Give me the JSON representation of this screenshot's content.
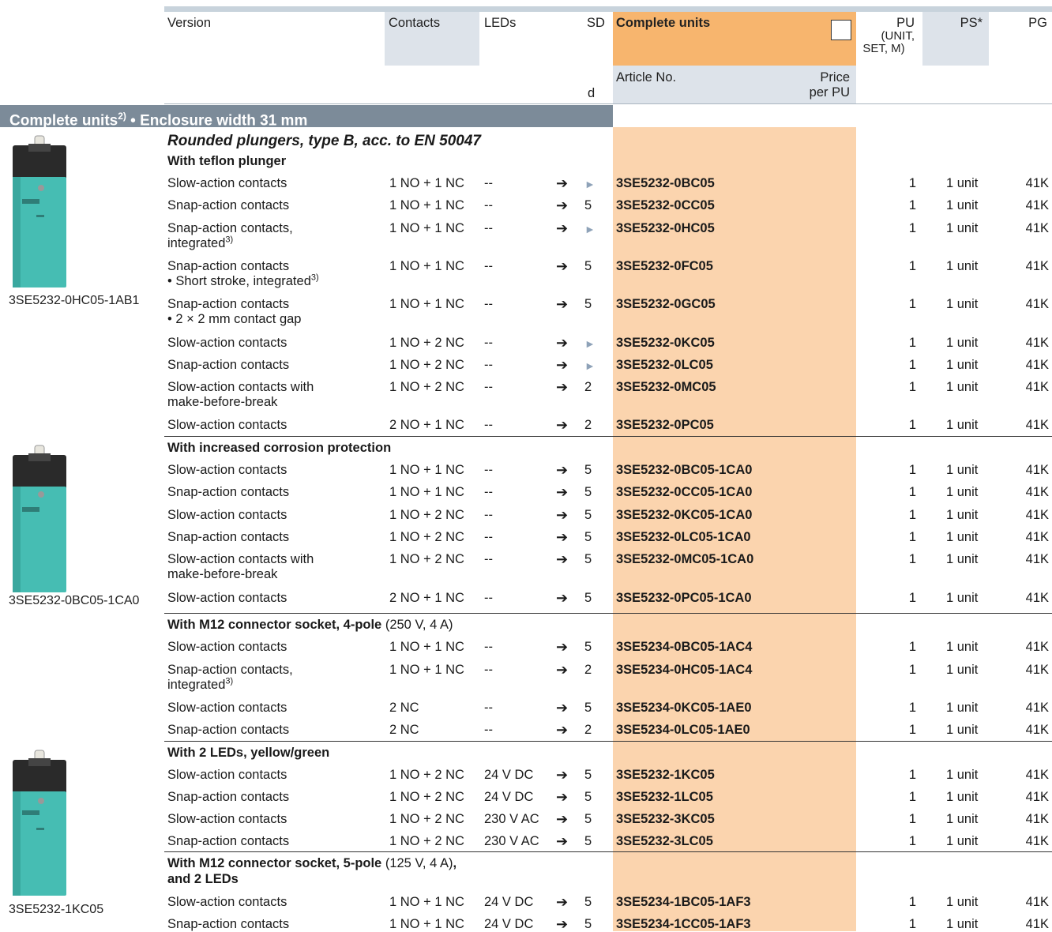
{
  "header": {
    "version": "Version",
    "contacts": "Contacts",
    "leds": "LEDs",
    "sd": "SD",
    "sd_unit": "d",
    "complete_units": "Complete units",
    "article_no": "Article No.",
    "price_line1": "Price",
    "price_line2": "per PU",
    "pu_line1": "PU",
    "pu_line2": "(UNIT,",
    "pu_line3": "SET, M)",
    "ps": "PS*",
    "pg": "PG"
  },
  "section": {
    "label": "Complete units",
    "sup": "2)",
    "rest": " • Enclosure width 31 mm"
  },
  "title": "Rounded plungers, type B, acc. to EN 50047",
  "subheads": {
    "teflon": "With teflon plunger",
    "corrosion": "With increased corrosion protection",
    "m12_4_bold": "With M12 connector socket, 4-pole",
    "m12_4_norm": " (250 V, 4 A)",
    "leds": "With 2 LEDs, yellow/green",
    "m12_5_bold": "With M12 connector socket, 5-pole",
    "m12_5_norm": " (125 V, 4 A)",
    "m12_5_comma": ",",
    "m12_5_line2": "and 2 LEDs"
  },
  "captions": {
    "img1": "3SE5232-0HC05-1AB1",
    "img2": "3SE5232-0BC05-1CA0",
    "img3": "3SE5232-1KC05"
  },
  "rows": [
    {
      "v1": "Slow-action contacts",
      "v2": "",
      "sup": "",
      "contacts": "1 NO + 1 NC",
      "leds": "--",
      "arrow": "➔",
      "sd": "►",
      "article": "3SE5232-0BC05",
      "pu": "1",
      "ps": "1 unit",
      "pg": "41K"
    },
    {
      "v1": "Snap-action contacts",
      "v2": "",
      "sup": "",
      "contacts": "1 NO + 1 NC",
      "leds": "--",
      "arrow": "➔",
      "sd": "5",
      "article": "3SE5232-0CC05",
      "pu": "1",
      "ps": "1 unit",
      "pg": "41K"
    },
    {
      "v1": "Snap-action contacts,",
      "v2": "integrated",
      "sup": "3)",
      "contacts": "1 NO + 1 NC",
      "leds": "--",
      "arrow": "➔",
      "sd": "►",
      "article": "3SE5232-0HC05",
      "pu": "1",
      "ps": "1 unit",
      "pg": "41K"
    },
    {
      "v1": "Snap-action contacts",
      "v2": "• Short stroke, integrated",
      "sup": "3)",
      "contacts": "1 NO + 1 NC",
      "leds": "--",
      "arrow": "➔",
      "sd": "5",
      "article": "3SE5232-0FC05",
      "pu": "1",
      "ps": "1 unit",
      "pg": "41K"
    },
    {
      "v1": "Snap-action contacts",
      "v2": "• 2 × 2 mm contact gap",
      "sup": "",
      "contacts": "1 NO + 1 NC",
      "leds": "--",
      "arrow": "➔",
      "sd": "5",
      "article": "3SE5232-0GC05",
      "pu": "1",
      "ps": "1 unit",
      "pg": "41K"
    },
    {
      "v1": "Slow-action contacts",
      "v2": "",
      "sup": "",
      "contacts": "1 NO + 2 NC",
      "leds": "--",
      "arrow": "➔",
      "sd": "►",
      "article": "3SE5232-0KC05",
      "pu": "1",
      "ps": "1 unit",
      "pg": "41K"
    },
    {
      "v1": "Snap-action contacts",
      "v2": "",
      "sup": "",
      "contacts": "1 NO + 2 NC",
      "leds": "--",
      "arrow": "➔",
      "sd": "►",
      "article": "3SE5232-0LC05",
      "pu": "1",
      "ps": "1 unit",
      "pg": "41K"
    },
    {
      "v1": "Slow-action contacts with",
      "v2": "make-before-break",
      "sup": "",
      "contacts": "1 NO + 2 NC",
      "leds": "--",
      "arrow": "➔",
      "sd": "2",
      "article": "3SE5232-0MC05",
      "pu": "1",
      "ps": "1 unit",
      "pg": "41K"
    },
    {
      "v1": "Slow-action contacts",
      "v2": "",
      "sup": "",
      "contacts": "2 NO + 1 NC",
      "leds": "--",
      "arrow": "➔",
      "sd": "2",
      "article": "3SE5232-0PC05",
      "pu": "1",
      "ps": "1 unit",
      "pg": "41K"
    },
    {
      "v1": "Slow-action contacts",
      "v2": "",
      "sup": "",
      "contacts": "1 NO + 1 NC",
      "leds": "--",
      "arrow": "➔",
      "sd": "5",
      "article": "3SE5232-0BC05-1CA0",
      "pu": "1",
      "ps": "1 unit",
      "pg": "41K"
    },
    {
      "v1": "Snap-action contacts",
      "v2": "",
      "sup": "",
      "contacts": "1 NO + 1 NC",
      "leds": "--",
      "arrow": "➔",
      "sd": "5",
      "article": "3SE5232-0CC05-1CA0",
      "pu": "1",
      "ps": "1 unit",
      "pg": "41K"
    },
    {
      "v1": "Slow-action contacts",
      "v2": "",
      "sup": "",
      "contacts": "1 NO + 2 NC",
      "leds": "--",
      "arrow": "➔",
      "sd": "5",
      "article": "3SE5232-0KC05-1CA0",
      "pu": "1",
      "ps": "1 unit",
      "pg": "41K"
    },
    {
      "v1": "Snap-action contacts",
      "v2": "",
      "sup": "",
      "contacts": "1 NO + 2 NC",
      "leds": "--",
      "arrow": "➔",
      "sd": "5",
      "article": "3SE5232-0LC05-1CA0",
      "pu": "1",
      "ps": "1 unit",
      "pg": "41K"
    },
    {
      "v1": "Slow-action contacts with",
      "v2": "make-before-break",
      "sup": "",
      "contacts": "1 NO + 2 NC",
      "leds": "--",
      "arrow": "➔",
      "sd": "5",
      "article": "3SE5232-0MC05-1CA0",
      "pu": "1",
      "ps": "1 unit",
      "pg": "41K"
    },
    {
      "v1": "Slow-action contacts",
      "v2": "",
      "sup": "",
      "contacts": "2 NO + 1 NC",
      "leds": "--",
      "arrow": "➔",
      "sd": "5",
      "article": "3SE5232-0PC05-1CA0",
      "pu": "1",
      "ps": "1 unit",
      "pg": "41K"
    },
    {
      "v1": "Slow-action contacts",
      "v2": "",
      "sup": "",
      "contacts": "1 NO + 1 NC",
      "leds": "--",
      "arrow": "➔",
      "sd": "5",
      "article": "3SE5234-0BC05-1AC4",
      "pu": "1",
      "ps": "1 unit",
      "pg": "41K"
    },
    {
      "v1": "Snap-action contacts,",
      "v2": "integrated",
      "sup": "3)",
      "contacts": "1 NO + 1 NC",
      "leds": "--",
      "arrow": "➔",
      "sd": "2",
      "article": "3SE5234-0HC05-1AC4",
      "pu": "1",
      "ps": "1 unit",
      "pg": "41K"
    },
    {
      "v1": "Slow-action contacts",
      "v2": "",
      "sup": "",
      "contacts": "2 NC",
      "leds": "--",
      "arrow": "➔",
      "sd": "5",
      "article": "3SE5234-0KC05-1AE0",
      "pu": "1",
      "ps": "1 unit",
      "pg": "41K"
    },
    {
      "v1": "Snap-action contacts",
      "v2": "",
      "sup": "",
      "contacts": "2 NC",
      "leds": "--",
      "arrow": "➔",
      "sd": "2",
      "article": "3SE5234-0LC05-1AE0",
      "pu": "1",
      "ps": "1 unit",
      "pg": "41K"
    },
    {
      "v1": "Slow-action contacts",
      "v2": "",
      "sup": "",
      "contacts": "1 NO + 2 NC",
      "leds": "24 V DC",
      "arrow": "➔",
      "sd": "5",
      "article": "3SE5232-1KC05",
      "pu": "1",
      "ps": "1 unit",
      "pg": "41K"
    },
    {
      "v1": "Snap-action contacts",
      "v2": "",
      "sup": "",
      "contacts": "1 NO + 2 NC",
      "leds": "24 V DC",
      "arrow": "➔",
      "sd": "5",
      "article": "3SE5232-1LC05",
      "pu": "1",
      "ps": "1 unit",
      "pg": "41K"
    },
    {
      "v1": "Slow-action contacts",
      "v2": "",
      "sup": "",
      "contacts": "1 NO + 2 NC",
      "leds": "230 V AC",
      "arrow": "➔",
      "sd": "5",
      "article": "3SE5232-3KC05",
      "pu": "1",
      "ps": "1 unit",
      "pg": "41K"
    },
    {
      "v1": "Snap-action contacts",
      "v2": "",
      "sup": "",
      "contacts": "1 NO + 2 NC",
      "leds": "230 V AC",
      "arrow": "➔",
      "sd": "5",
      "article": "3SE5232-3LC05",
      "pu": "1",
      "ps": "1 unit",
      "pg": "41K"
    },
    {
      "v1": "Slow-action contacts",
      "v2": "",
      "sup": "",
      "contacts": "1 NO + 1 NC",
      "leds": "24 V DC",
      "arrow": "➔",
      "sd": "5",
      "article": "3SE5234-1BC05-1AF3",
      "pu": "1",
      "ps": "1 unit",
      "pg": "41K"
    },
    {
      "v1": "Snap-action contacts",
      "v2": "",
      "sup": "",
      "contacts": "1 NO + 1 NC",
      "leds": "24 V DC",
      "arrow": "➔",
      "sd": "5",
      "article": "3SE5234-1CC05-1AF3",
      "pu": "1",
      "ps": "1 unit",
      "pg": "41K"
    }
  ]
}
